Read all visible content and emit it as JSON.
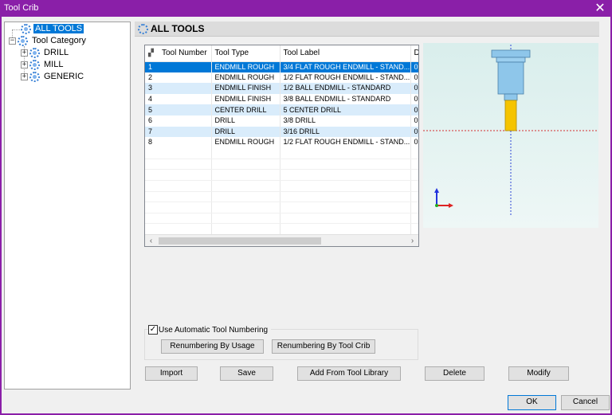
{
  "window": {
    "title": "Tool Crib",
    "close_glyph": "✕"
  },
  "tree": {
    "items": [
      {
        "label": "ALL TOOLS",
        "icon": "gear-icon",
        "selected": true
      },
      {
        "label": "Tool Category",
        "icon": "gear-icon",
        "expander": "−"
      },
      {
        "label": "DRILL",
        "icon": "gear-icon",
        "expander": "+"
      },
      {
        "label": "MILL",
        "icon": "gear-icon",
        "expander": "+"
      },
      {
        "label": "GENERIC",
        "icon": "gear-icon",
        "expander": "+"
      }
    ]
  },
  "panel": {
    "title": "ALL TOOLS"
  },
  "grid": {
    "columns": [
      "Tool Number",
      "Tool Type",
      "Tool Label",
      "D"
    ],
    "rows": [
      [
        "1",
        "ENDMILL ROUGH",
        "3/4 FLAT ROUGH ENDMILL - STAND...",
        "0"
      ],
      [
        "2",
        "ENDMILL ROUGH",
        "1/2 FLAT ROUGH ENDMILL - STAND...",
        "0"
      ],
      [
        "3",
        "ENDMILL FINISH",
        "1/2 BALL ENDMILL - STANDARD",
        "0"
      ],
      [
        "4",
        "ENDMILL FINISH",
        "3/8 BALL ENDMILL - STANDARD",
        "0"
      ],
      [
        "5",
        "CENTER DRILL",
        "5 CENTER DRILL",
        "0"
      ],
      [
        "6",
        "DRILL",
        "3/8 DRILL",
        "0"
      ],
      [
        "7",
        "DRILL",
        "3/16 DRILL",
        "0"
      ],
      [
        "8",
        "ENDMILL ROUGH",
        "1/2 FLAT ROUGH ENDMILL - STAND...",
        "0"
      ]
    ],
    "selected_row": 0,
    "scroll_left": "‹",
    "scroll_right": "›"
  },
  "numbering": {
    "checkbox_label": "Use Automatic Tool Numbering",
    "checked": true,
    "check_glyph": "✓",
    "by_usage": "Renumbering By Usage",
    "by_crib": "Renumbering By Tool Crib"
  },
  "actions": {
    "import": "Import",
    "save": "Save",
    "add_from_library": "Add From Tool Library",
    "delete": "Delete",
    "modify": "Modify"
  },
  "dialog": {
    "ok": "OK",
    "cancel": "Cancel"
  },
  "colors": {
    "titlebar": "#8a1fa8",
    "selection": "#0078d7",
    "alt_row": "#d9ecfb",
    "tool_holder": "#8ec6ea",
    "tool_shank": "#f5c400"
  }
}
